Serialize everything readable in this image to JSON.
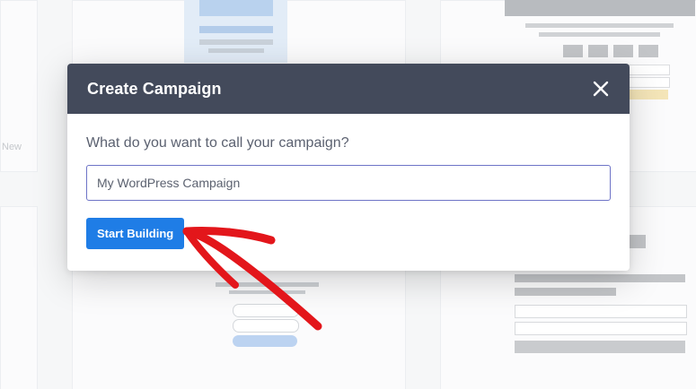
{
  "background": {
    "partial_label": "New"
  },
  "modal": {
    "title": "Create Campaign",
    "prompt": "What do you want to call your campaign?",
    "campaign_name_value": "",
    "campaign_name_placeholder": "My WordPress Campaign",
    "start_button_label": "Start Building",
    "close_icon": "close-icon"
  },
  "annotation": {
    "arrow_color": "#e3161b"
  },
  "colors": {
    "header_bg": "#434a5b",
    "accent": "#1f7de6",
    "input_border": "#6e74c7"
  }
}
